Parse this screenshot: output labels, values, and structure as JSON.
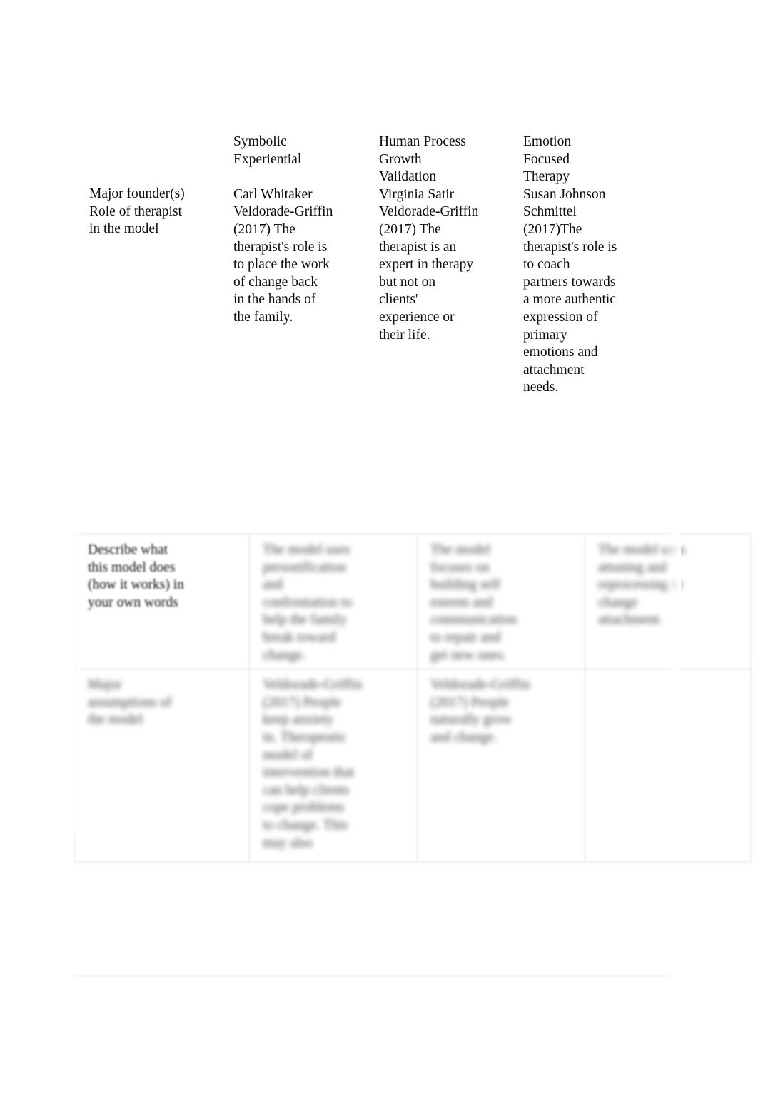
{
  "document": {
    "page_background": "#ffffff",
    "text_color": "#000000",
    "border_color": "#d9d9d9"
  },
  "comparison": {
    "row_label": "Major founder(s)\nRole of therapist\nin the model",
    "columns": [
      {
        "heading": "Symbolic\nExperiential",
        "body": "Carl Whitaker\nVeldorade-Griffin\n(2017) The\ntherapist's role is\nto place the work\nof change back\nin the hands of\nthe family."
      },
      {
        "heading": "Human Process\nGrowth\nValidation",
        "body": "Virginia Satir\nVeldorade-Griffin\n(2017) The\ntherapist is an\nexpert in therapy\nbut not on\nclients'\nexperience or\ntheir life."
      },
      {
        "heading": "Emotion\nFocused\nTherapy",
        "body": "Susan Johnson\nSchmittel\n(2017)The\ntherapist's role is\nto coach\npartners towards\na more authentic\nexpression of\nprimary\nemotions and\nattachment\nneeds."
      }
    ]
  },
  "table": {
    "rows": [
      {
        "label": "Describe what\nthis model does\n(how it works) in\nyour own words",
        "label_legible": true,
        "cells": [
          {
            "text": "The model uses\npersonification\nand\nconfrontation to\nhelp the family\nbreak toward\nchange.",
            "legible": false
          },
          {
            "text": "The model\nfocuses on\nbuilding self\nesteem and\ncommunication\nto repair and\nget new ones.",
            "legible": false
          },
          {
            "text": "The model uses\nattuning and\nreprocessing to\nchange\nattachment.",
            "legible": false
          }
        ]
      },
      {
        "label": "Major\nassumptions of\nthe model",
        "label_legible": false,
        "cells": [
          {
            "text": "Veldorade-Griffin\n(2017) People\nkeep anxiety\nin. Therapeutic\nmodel of\nintervention that\ncan help clients\ncope problems\nto change. This\nmay also",
            "legible": false
          },
          {
            "text": "Veldorade-Griffin\n(2017) People\nnaturally grow\nand change.",
            "legible": false
          },
          {
            "text": "",
            "legible": false
          }
        ]
      }
    ]
  }
}
